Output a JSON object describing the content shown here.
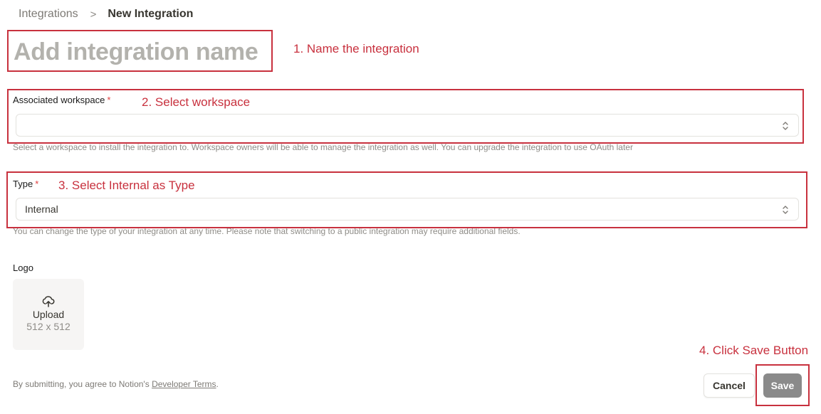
{
  "breadcrumb": {
    "parent": "Integrations",
    "separator": ">",
    "current": "New Integration"
  },
  "name_input": {
    "placeholder": "Add integration name",
    "value": ""
  },
  "workspace": {
    "label": "Associated workspace",
    "required_mark": "*",
    "value": "",
    "help": "Select a workspace to install the integration to. Workspace owners will be able to manage the integration as well. You can upgrade the integration to use OAuth later"
  },
  "type": {
    "label": "Type",
    "required_mark": "*",
    "value": "Internal",
    "help": "You can change the type of your integration at any time. Please note that switching to a public integration may require additional fields."
  },
  "logo": {
    "label": "Logo",
    "upload_label": "Upload",
    "size_hint": "512 x 512",
    "icon": "cloud-upload-icon"
  },
  "footer": {
    "text": "By submitting, you agree to Notion's ",
    "link": "Developer Terms",
    "suffix": "."
  },
  "buttons": {
    "cancel": "Cancel",
    "save": "Save"
  },
  "annotations": {
    "step1": "1. Name the integration",
    "step2": "2. Select workspace",
    "step3": "3. Select Internal as Type",
    "step4": "4. Click Save Button"
  },
  "colors": {
    "annotation_red": "#c8313e",
    "save_button": "#8a8a8a",
    "required_star": "#e03e3e"
  }
}
